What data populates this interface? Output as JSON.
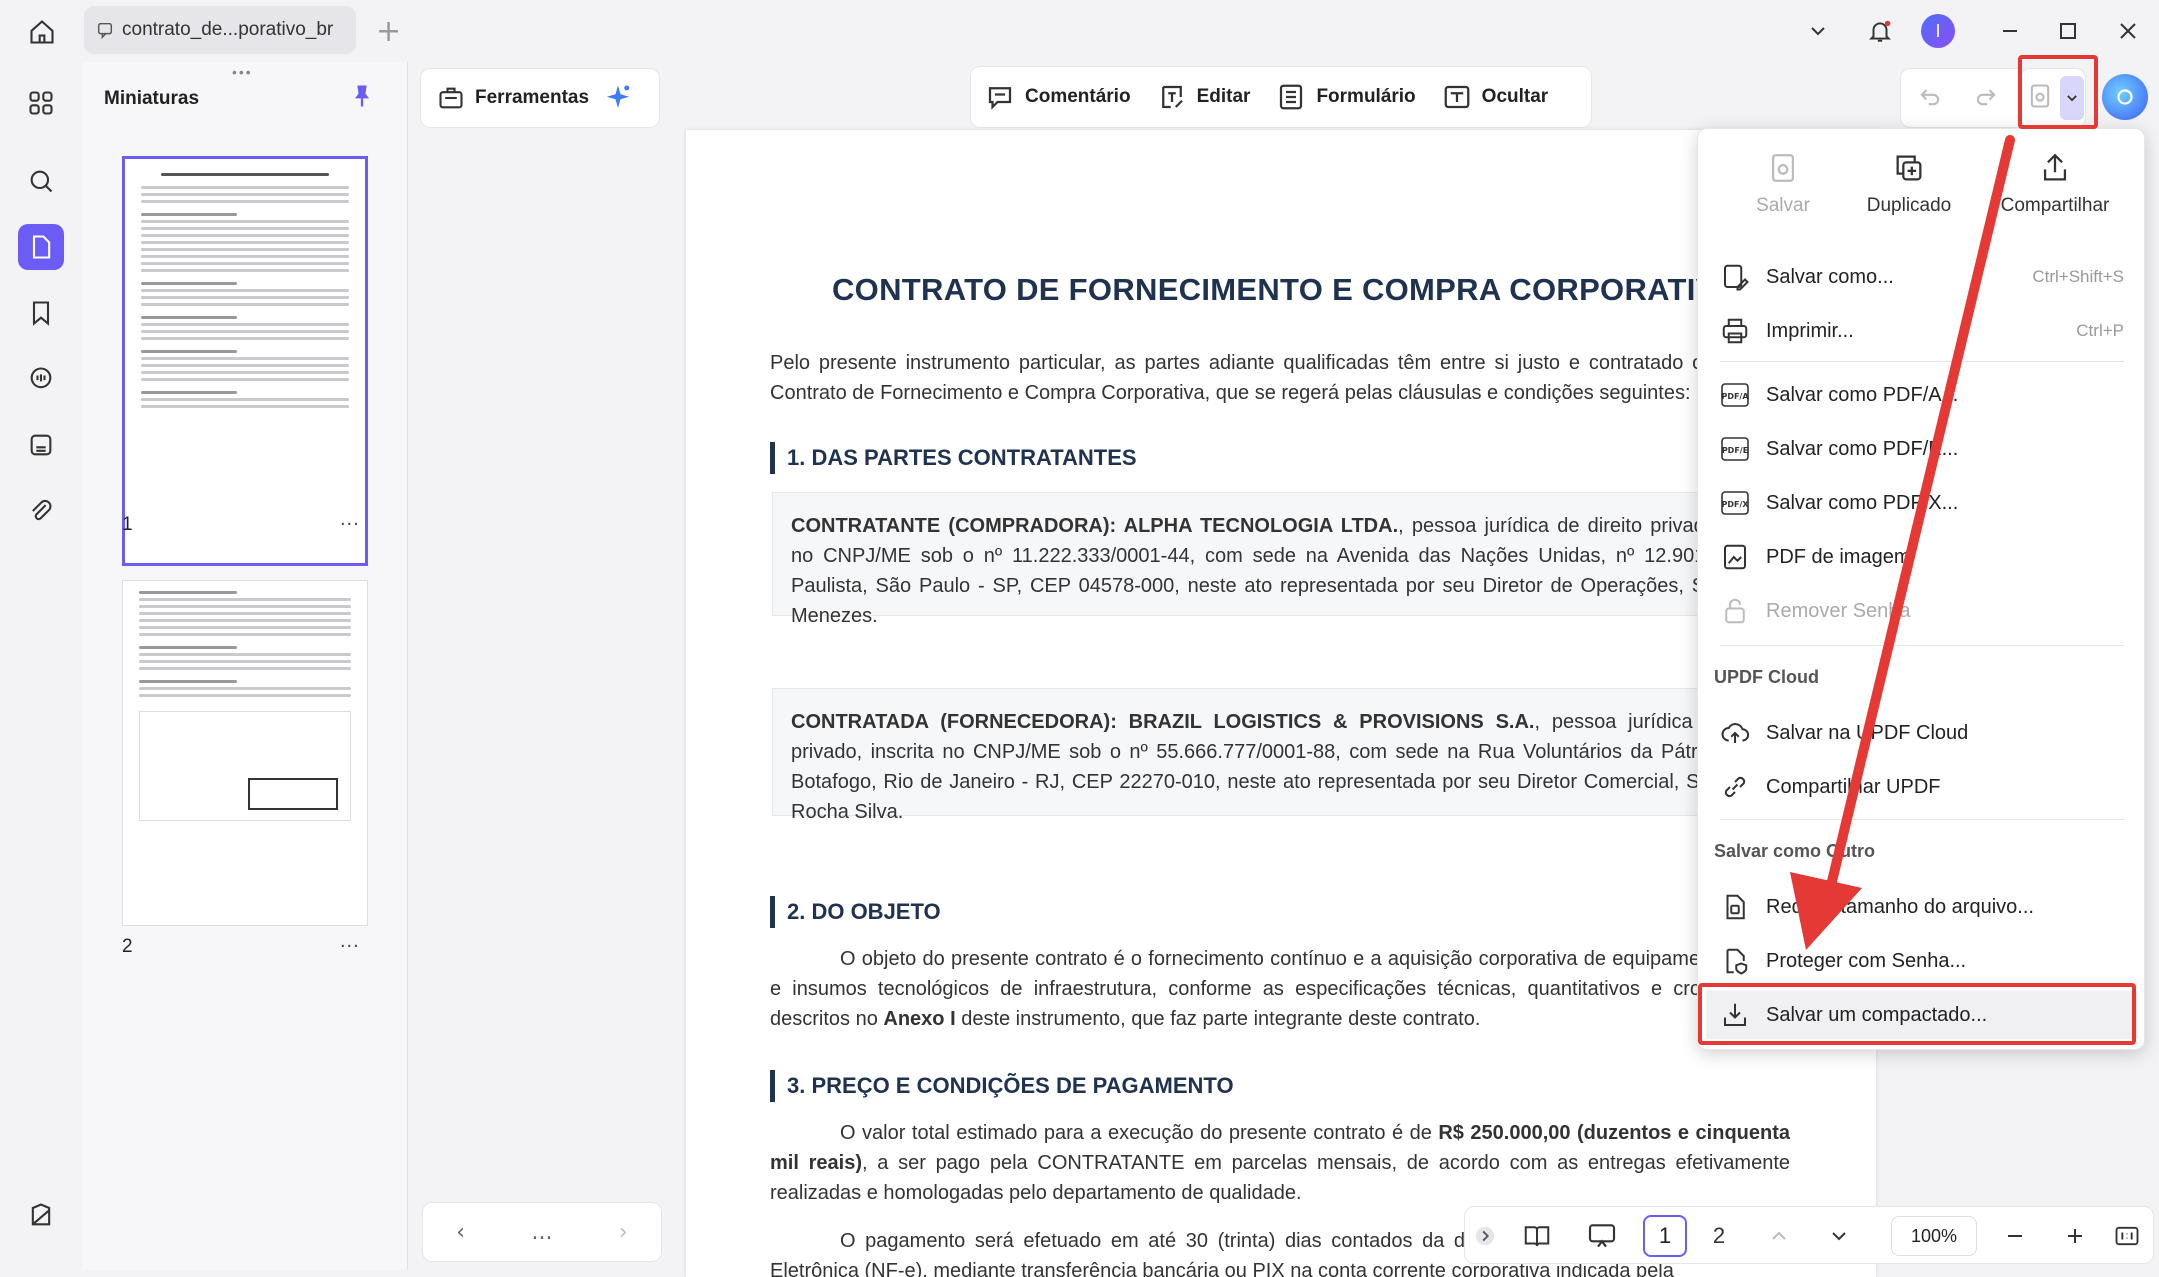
{
  "titlebar": {
    "tab_title": "contrato_de...porativo_br"
  },
  "thumbnails": {
    "title": "Miniaturas",
    "pages": [
      {
        "number": "1"
      },
      {
        "number": "2"
      }
    ],
    "more": "..."
  },
  "tools": {
    "ferramentas": "Ferramentas"
  },
  "toolbar": {
    "comentario": "Comentário",
    "editar": "Editar",
    "formulario": "Formulário",
    "ocultar": "Ocultar"
  },
  "document": {
    "title": "CONTRATO DE FORNECIMENTO E COMPRA CORPORATIVO",
    "intro": "Pelo presente instrumento particular, as partes adiante qualificadas têm entre si justo e contratado o presente Contrato de Fornecimento e Compra Corporativa, que se regerá pelas cláusulas e condições seguintes:",
    "sec1": "1. DAS PARTES CONTRATANTES",
    "contratante_bold": "CONTRATANTE (COMPRADORA): ALPHA TECNOLOGIA LTDA.",
    "contratante_text": ", pessoa jurídica de direito privado, inscrita no CNPJ/ME sob o nº 11.222.333/0001-44, com sede na Avenida das Nações Unidas, nº 12.901, Brooklin Paulista, São Paulo - SP, CEP 04578-000, neste ato representada por seu Diretor de Operações, Sr. Ricardo Menezes.",
    "contratada_bold": "CONTRATADA (FORNECEDORA): BRAZIL LOGISTICS & PROVISIONS S.A.",
    "contratada_text": ", pessoa jurídica de direito privado, inscrita no CNPJ/ME sob o nº 55.666.777/0001-88, com sede na Rua Voluntários da Pátria, nº 450, Botafogo, Rio de Janeiro - RJ, CEP 22270-010, neste ato representada por seu Diretor Comercial, Sr. Eduardo Rocha Silva.",
    "sec2": "2. DO OBJETO",
    "objeto_a": "O objeto do presente contrato é o fornecimento contínuo e a aquisição corporativa de equipamentos de TI e insumos tecnológicos de infraestrutura, conforme as especificações técnicas, quantitativos e cronogramas descritos no ",
    "objeto_bold": "Anexo I",
    "objeto_b": " deste instrumento, que faz parte integrante deste contrato.",
    "sec3": "3. PREÇO E CONDIÇÕES DE PAGAMENTO",
    "preco_a": "O valor total estimado para a execução do presente contrato é de ",
    "preco_bold": "R$ 250.000,00 (duzentos e cinquenta mil reais)",
    "preco_b": ", a ser pago pela CONTRATANTE em parcelas mensais, de acordo com as entregas efetivamente realizadas e homologadas pelo departamento de qualidade.",
    "pagamento": "O pagamento será efetuado em até 30 (trinta) dias contados da data de recebimento da Nota Fiscal Eletrônica (NF-e), mediante transferência bancária ou PIX na conta corrente corporativa indicada pela"
  },
  "menu": {
    "top": [
      {
        "label": "Salvar",
        "icon": "save-icon",
        "disabled": true
      },
      {
        "label": "Duplicado",
        "icon": "duplicate-icon",
        "disabled": false
      },
      {
        "label": "Compartilhar",
        "icon": "share-icon",
        "disabled": false
      }
    ],
    "salvar_como": "Salvar como...",
    "salvar_como_sc": "Ctrl+Shift+S",
    "imprimir": "Imprimir...",
    "imprimir_sc": "Ctrl+P",
    "pdfa": "Salvar como PDF/A...",
    "pdfe": "Salvar como PDF/E...",
    "pdfx": "Salvar como PDF/X...",
    "pdf_imagem": "PDF de imagem",
    "remover_senha": "Remover Senha",
    "cloud_head": "UPDF Cloud",
    "salvar_cloud": "Salvar na UPDF Cloud",
    "compartilhar_updf": "Compartilhar UPDF",
    "outro_head": "Salvar como Outro",
    "reduzir": "Reduzir tamanho do arquivo...",
    "proteger": "Proteger com Senha...",
    "compactado": "Salvar um compactado..."
  },
  "bottombar": {
    "page1": "1",
    "page2": "2",
    "zoom": "100%",
    "more": "..."
  },
  "colors": {
    "accent": "#6b5cf6",
    "annotation": "#e53935",
    "heading": "#1f3250"
  }
}
